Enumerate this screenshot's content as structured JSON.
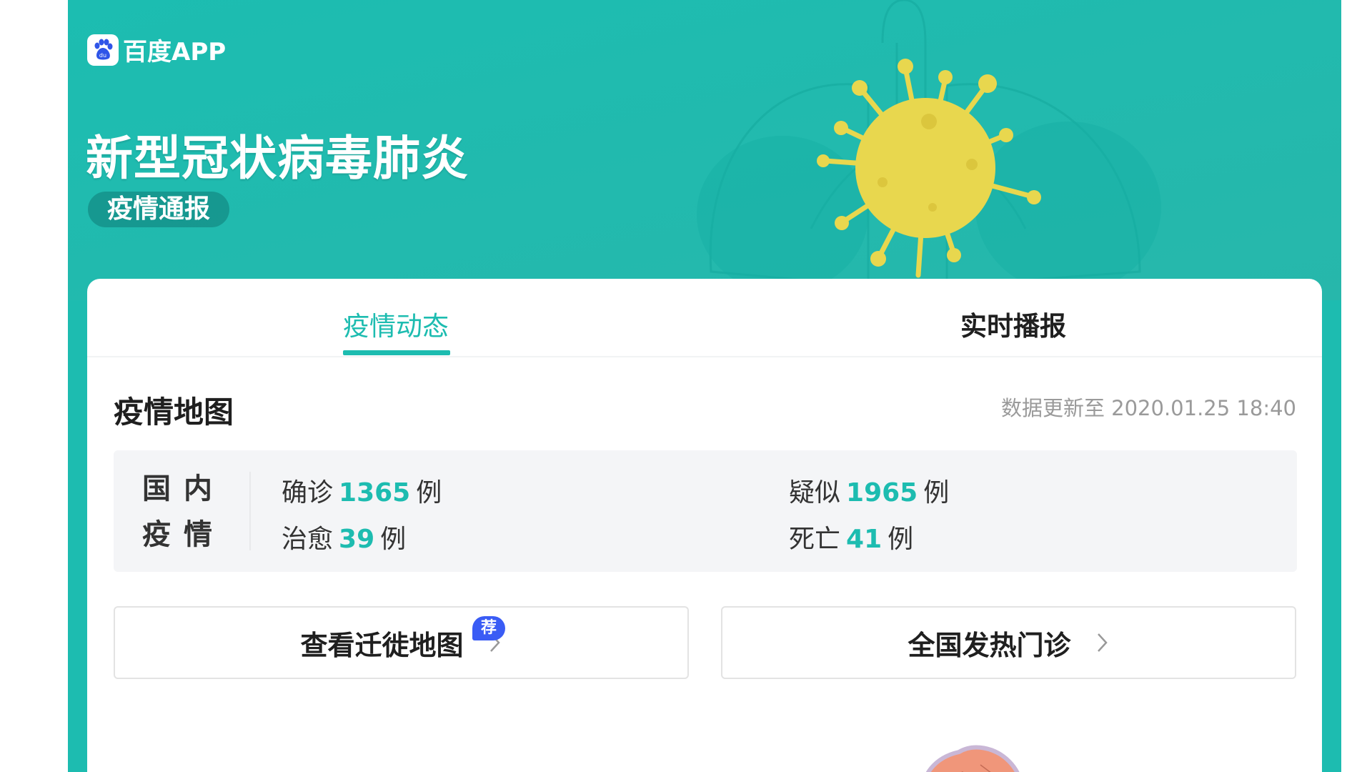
{
  "brand": {
    "name": "百度APP",
    "logo_icon": "paw-icon"
  },
  "header": {
    "title": "新型冠状病毒肺炎",
    "subtitle": "疫情通报"
  },
  "tabs": [
    {
      "label": "疫情动态",
      "active": true
    },
    {
      "label": "实时播报",
      "active": false
    }
  ],
  "map_section": {
    "title": "疫情地图",
    "update_time": "数据更新至 2020.01.25 18:40"
  },
  "domestic": {
    "label_line1": "国内",
    "label_line2": "疫情",
    "confirmed": {
      "label": "确诊",
      "value": "1365",
      "unit": "例"
    },
    "suspected": {
      "label": "疑似",
      "value": "1965",
      "unit": "例"
    },
    "cured": {
      "label": "治愈",
      "value": "39",
      "unit": "例"
    },
    "dead": {
      "label": "死亡",
      "value": "41",
      "unit": "例"
    }
  },
  "actions": {
    "migration": {
      "label": "查看迁徙地图",
      "badge": "荐",
      "icon": "chevron-right-icon"
    },
    "fever_clinic": {
      "label": "全国发热门诊",
      "icon": "chevron-right-icon"
    }
  },
  "colors": {
    "brand_teal": "#1dbcb0",
    "virus_yellow": "#e8d74e",
    "badge_blue": "#3a5cf5",
    "map_salmon": "#f0967a"
  }
}
